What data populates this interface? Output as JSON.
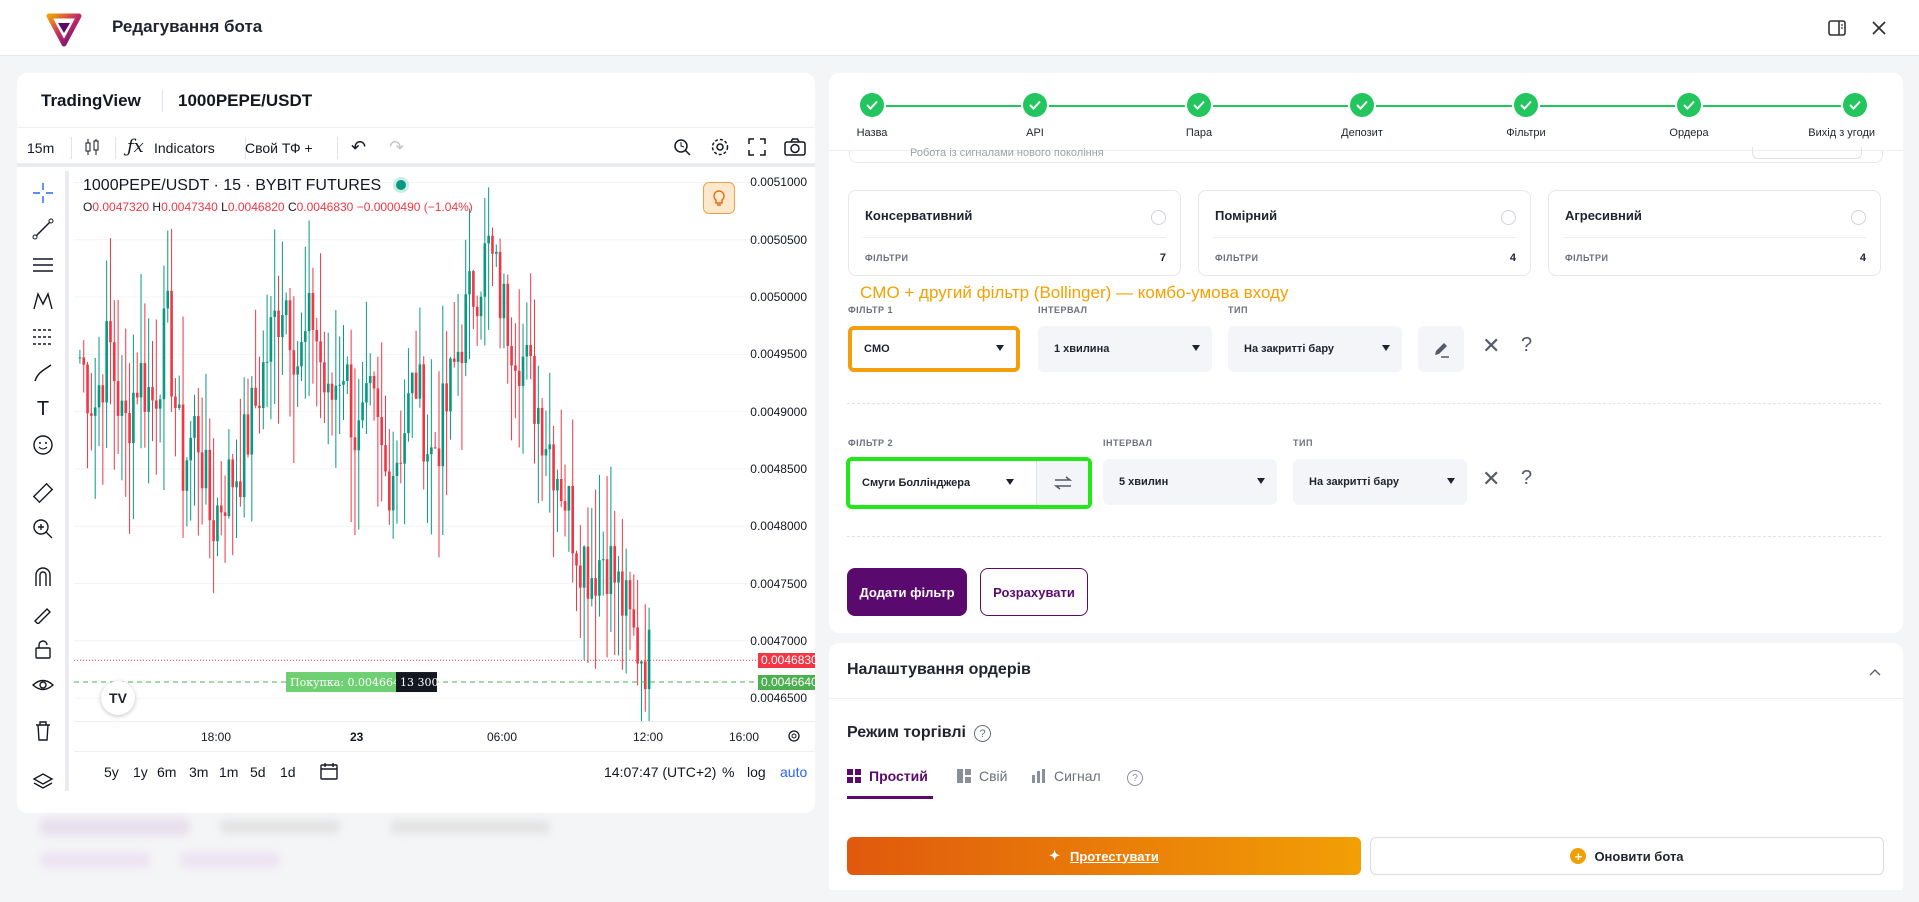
{
  "header": {
    "title": "Редагування бота"
  },
  "chart": {
    "brand": "TradingView",
    "symbol": "1000PEPE/USDT",
    "toolbar": {
      "interval": "15m",
      "indicators": "Indicators",
      "custom_tf": "Свой ТФ +"
    },
    "legend": {
      "title": "1000PEPE/USDT · 15 · BYBIT FUTURES",
      "o_label": "O",
      "o": "0.0047320",
      "h_label": "H",
      "h": "0.0047340",
      "l_label": "L",
      "l": "0.0046820",
      "c_label": "C",
      "c": "0.0046830",
      "change": "−0.0000490 (−1.04%)"
    },
    "price_labels": [
      "0.0051000",
      "0.0050500",
      "0.0050000",
      "0.0049500",
      "0.0049000",
      "0.0048500",
      "0.0048000",
      "0.0047500",
      "0.0047000",
      "0.0046500"
    ],
    "last_price": "0.0046830",
    "buy_price": "0.0046640",
    "buy_label": "Покупка: 0.004664",
    "buy_qty": "13 300",
    "time_labels": [
      "18:00",
      "23",
      "06:00",
      "12:00",
      "16:00"
    ],
    "ranges": [
      "5y",
      "1y",
      "6m",
      "3m",
      "1m",
      "5d",
      "1d"
    ],
    "clock": "14:07:47 (UTC+2)",
    "pct": "%",
    "log": "log",
    "auto": "auto",
    "colors": {
      "up": "#089981",
      "down": "#f23645"
    }
  },
  "chart_data": {
    "type": "candlestick",
    "title": "1000PEPE/USDT · 15 · BYBIT FUTURES",
    "ylim": [
      0.00463,
      0.00511
    ],
    "x_ticks": [
      "18:00",
      "23",
      "06:00",
      "12:00",
      "16:00"
    ],
    "close_series": [
      0.004948,
      0.004905,
      0.004962,
      0.00488,
      0.004935,
      0.00491,
      0.004975,
      0.00485,
      0.00489,
      0.0048,
      0.004835,
      0.004855,
      0.004905,
      0.00496,
      0.00501,
      0.00494,
      0.004985,
      0.0049,
      0.00495,
      0.00487,
      0.004905,
      0.00484,
      0.004875,
      0.00493,
      0.00486,
      0.004895,
      0.00496,
      0.00501,
      0.00504,
      0.00499,
      0.00496,
      0.00492,
      0.00488,
      0.00484,
      0.00479,
      0.00476,
      0.00478,
      0.00474,
      0.0047,
      0.004683
    ]
  },
  "stepper": {
    "steps": [
      "Назва",
      "API",
      "Пара",
      "Депозит",
      "Фільтри",
      "Ордера",
      "Вихід з угоди"
    ]
  },
  "partial_text": "Робота із сигналами нового покоління",
  "strategies": [
    {
      "name": "Консервативний",
      "filters_label": "ФІЛЬТРИ",
      "count": "7"
    },
    {
      "name": "Помірний",
      "filters_label": "ФІЛЬТРИ",
      "count": "4"
    },
    {
      "name": "Агресивний",
      "filters_label": "ФІЛЬТРИ",
      "count": "4"
    }
  ],
  "annotation": "CMO + другий фільтр (Bollinger) — комбо-умова входу",
  "filter1": {
    "label": "ФІЛЬТР 1",
    "value": "CMO",
    "interval_label": "ІНТЕРВАЛ",
    "interval": "1 хвилина",
    "type_label": "ТИП",
    "type": "На закритті бару",
    "highlight": "#f59e0b"
  },
  "filter2": {
    "label": "ФІЛЬТР 2",
    "value": "Смуги Боллінджера",
    "interval_label": "ІНТЕРВАЛ",
    "interval": "5 хвилин",
    "type_label": "ТИП",
    "type": "На закритті бару",
    "highlight": "#22e81a"
  },
  "buttons": {
    "add_filter": "Додати фільтр",
    "calculate": "Розрахувати"
  },
  "orders": {
    "title": "Налаштування ордерів",
    "mode_title": "Режим торгівлі",
    "tabs": [
      "Простий",
      "Свій",
      "Сигнал"
    ]
  },
  "footer": {
    "test": "Протестувати",
    "update": "Оновити бота"
  },
  "colors": {
    "accent": "#5a0a6e",
    "success": "#22c55e",
    "orange": "#f29f05"
  }
}
